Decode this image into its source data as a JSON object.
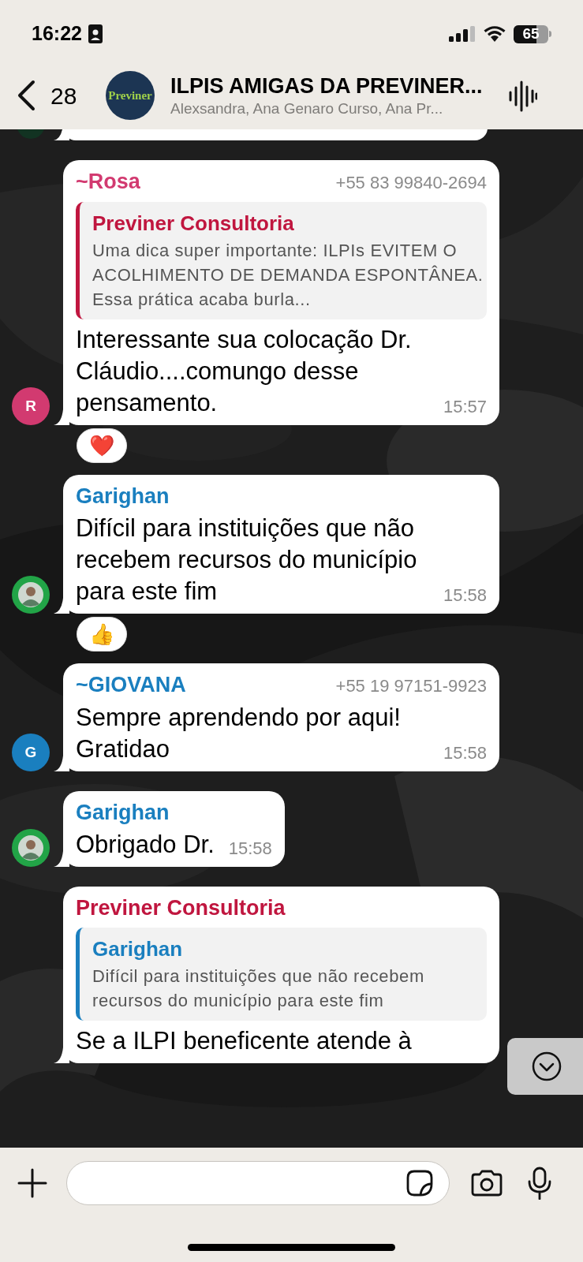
{
  "status_bar": {
    "time": "16:22",
    "battery": "65"
  },
  "header": {
    "back_count": "28",
    "avatar_text": "Previner",
    "title": "ILPIS AMIGAS DA PREVINER...",
    "subtitle": "Alexsandra, Ana Genaro Curso, Ana Pr..."
  },
  "messages": [
    {
      "kind": "partial"
    },
    {
      "kind": "message",
      "sender": "~Rosa",
      "color": "#d23a70",
      "phone": "+55 83 99840-2694",
      "avatar": {
        "kind": "initial",
        "letter": "R"
      },
      "quote": {
        "sender": "Previner Consultoria",
        "color": "#c0163f",
        "text": "Uma dica super importante: ILPIs EVITEM O ACOLHIMENTO DE DEMANDA ESPONTÂNEA. Essa prática acaba burla..."
      },
      "text": "Interessante sua colocação Dr. Cláudio....comungo desse pensamento.",
      "time": "15:57",
      "reaction": "❤️"
    },
    {
      "kind": "message",
      "sender": "Garighan",
      "color": "#1a7fbf",
      "text": "Difícil para instituições que não recebem recursos do município para este fim",
      "time": "15:58",
      "reaction": "👍"
    },
    {
      "kind": "message",
      "sender": "~GIOVANA",
      "color": "#1a7fbf",
      "phone": "+55 19 97151-9923",
      "avatar": {
        "kind": "initial",
        "letter": "G"
      },
      "text": "Sempre aprendendo por aqui! Gratidao",
      "time": "15:58"
    },
    {
      "kind": "message",
      "sender": "Garighan",
      "color": "#1a7fbf",
      "text": "Obrigado Dr.",
      "time": "15:58"
    },
    {
      "kind": "message",
      "sender": "Previner Consultoria",
      "color": "#c0163f",
      "quote": {
        "sender": "Garighan",
        "color": "#1a7fbf",
        "text": "Difícil para instituições que não recebem recursos do município para este fim"
      },
      "text": "Se a ILPI beneficente atende à"
    }
  ]
}
